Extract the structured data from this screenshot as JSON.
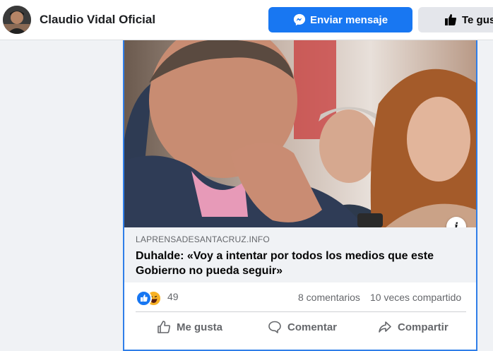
{
  "header": {
    "page_name": "Claudio Vidal Oficial",
    "message_button": "Enviar mensaje",
    "like_page_button": "Te gusta"
  },
  "post": {
    "link": {
      "domain": "LAPRENSADESANTACRUZ.INFO",
      "title": "Duhalde: «Voy a intentar por todos los medios que este Gobierno no pueda seguir»"
    },
    "reactions": {
      "count": "49",
      "types": [
        "like-icon",
        "haha-icon"
      ]
    },
    "comments": "8 comentarios",
    "shares": "10 veces compartido",
    "actions": {
      "like": "Me gusta",
      "comment": "Comentar",
      "share": "Compartir"
    }
  },
  "colors": {
    "brand": "#1877f2",
    "card_outline": "#2f7ee8",
    "meta_background": "#f0f2f5",
    "muted_text": "#65676b"
  }
}
